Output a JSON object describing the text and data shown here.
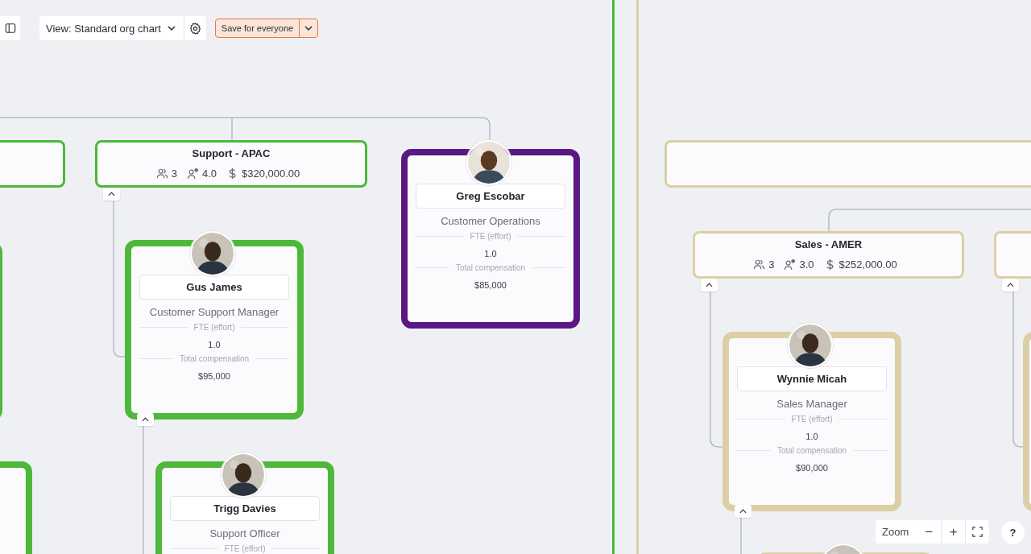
{
  "toolbar": {
    "view_select": "View: Standard org chart",
    "save_button": "Save for everyone"
  },
  "regions": [
    {
      "color": "#4db83a"
    },
    {
      "color": "#dccfa4"
    }
  ],
  "groups": [
    {
      "color": "#4db83a"
    },
    {
      "title": "Support - APAC",
      "headcount": "3",
      "fte": "4.0",
      "cost": "$320,000.00",
      "color": "#4db83a",
      "expanded": true
    },
    {
      "color": "#dccfa4"
    },
    {
      "title": "Sales - AMER",
      "headcount": "3",
      "fte": "3.0",
      "cost": "$252,000.00",
      "color": "#dccfa4",
      "expanded": true
    },
    {
      "color": "#dccfa4",
      "expanded": true
    }
  ],
  "people": [
    {
      "color": "#4db83a"
    },
    {
      "name": "Gus James",
      "title": "Customer Support Manager",
      "fte_label": "FTE (effort)",
      "fte": "1.0",
      "comp_label": "Total compensation",
      "comp": "$95,000",
      "color": "#4db83a",
      "expanded": true
    },
    {
      "name": "Greg Escobar",
      "title": "Customer Operations",
      "fte_label": "FTE (effort)",
      "fte": "1.0",
      "comp_label": "Total compensation",
      "comp": "$85,000",
      "color": "#5a1882"
    },
    {
      "name": "Trigg Davies",
      "title": "Support Officer",
      "fte_label": "FTE (effort)",
      "color": "#4db83a"
    },
    {
      "color": "#4db83a"
    },
    {
      "name": "Wynnie Micah",
      "title": "Sales Manager",
      "fte_label": "FTE (effort)",
      "fte": "1.0",
      "comp_label": "Total compensation",
      "comp": "$90,000",
      "color": "#dccfa4",
      "expanded": true
    },
    {
      "color": "#dccfa4"
    },
    {
      "color": "#dccfa4"
    }
  ],
  "zoom": {
    "label": "Zoom",
    "minus": "−",
    "plus": "+"
  },
  "help": "?"
}
